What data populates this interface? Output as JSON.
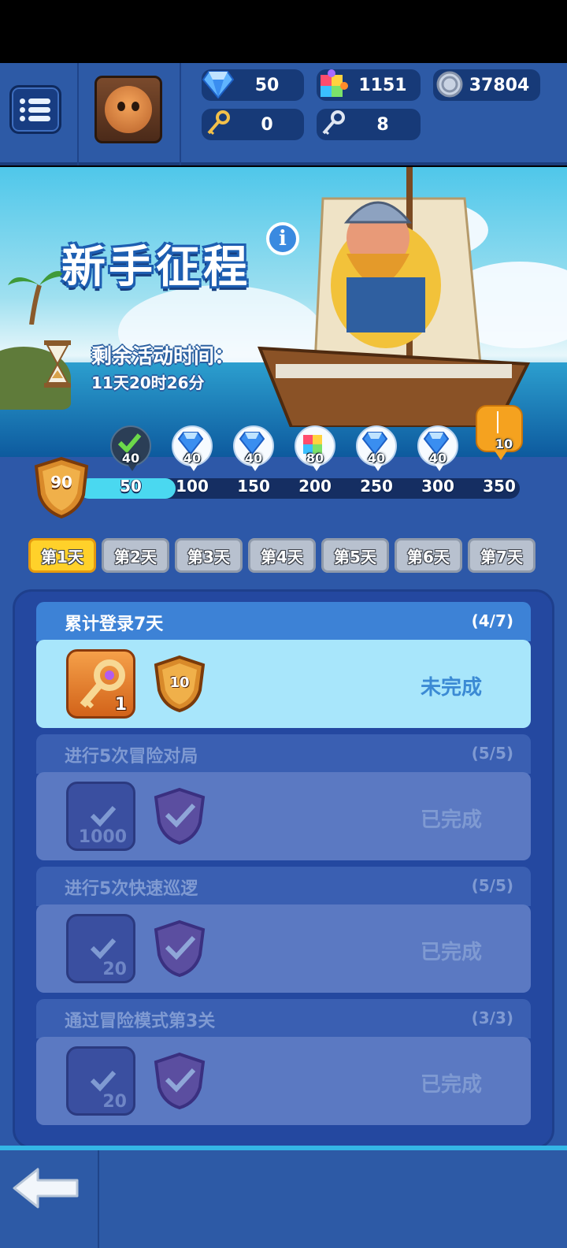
{
  "header": {
    "resources": [
      {
        "name": "diamonds",
        "value": "50"
      },
      {
        "name": "puzzle",
        "value": "1151"
      },
      {
        "name": "coins",
        "value": "37804"
      },
      {
        "name": "gold-key",
        "value": "0"
      },
      {
        "name": "silver-key",
        "value": "8"
      }
    ]
  },
  "banner": {
    "title": "新手征程",
    "time_label": "剩余活动时间：",
    "time_value": "11天20时26分"
  },
  "progress": {
    "current_points": "90",
    "fill_fraction": 0.22,
    "ticks": [
      "50",
      "100",
      "150",
      "200",
      "250",
      "300",
      "350"
    ],
    "rewards": [
      {
        "type": "diamond",
        "amount": "40",
        "claimed": true
      },
      {
        "type": "diamond",
        "amount": "40",
        "claimed": false
      },
      {
        "type": "diamond",
        "amount": "40",
        "claimed": false
      },
      {
        "type": "puzzle",
        "amount": "80",
        "claimed": false
      },
      {
        "type": "diamond",
        "amount": "40",
        "claimed": false
      },
      {
        "type": "diamond",
        "amount": "40",
        "claimed": false
      },
      {
        "type": "sword",
        "amount": "10",
        "claimed": false
      }
    ]
  },
  "days": [
    "第1天",
    "第2天",
    "第3天",
    "第4天",
    "第5天",
    "第6天",
    "第7天"
  ],
  "active_day": 0,
  "tasks": [
    {
      "name": "累计登录7天",
      "progress": "(4/7)",
      "state": "未完成",
      "reward_qty": "1",
      "shield_qty": "10"
    },
    {
      "name": "进行5次冒险对局",
      "progress": "(5/5)",
      "state": "已完成",
      "reward_qty": "1000"
    },
    {
      "name": "进行5次快速巡逻",
      "progress": "(5/5)",
      "state": "已完成",
      "reward_qty": "20"
    },
    {
      "name": "通过冒险模式第3关",
      "progress": "(3/3)",
      "state": "已完成",
      "reward_qty": "20"
    }
  ],
  "colors": {
    "accent": "#2d5aa6",
    "active_tab": "#ffd12a",
    "progress_fill": "#4ad8f0"
  }
}
